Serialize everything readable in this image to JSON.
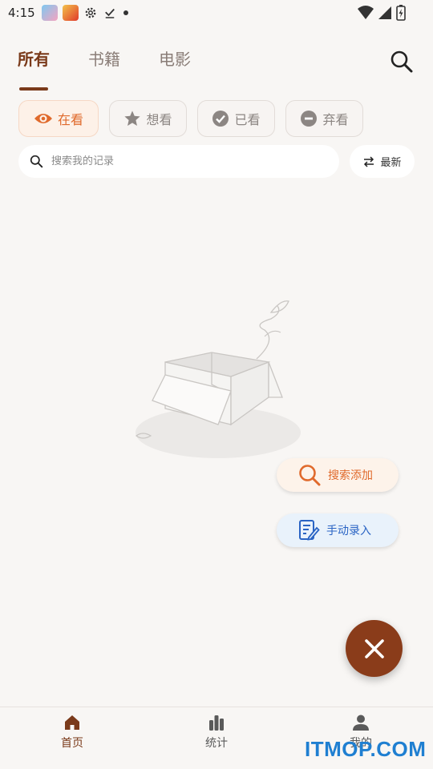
{
  "status_bar": {
    "time": "4:15"
  },
  "tabs": [
    {
      "label": "所有",
      "active": true
    },
    {
      "label": "书籍",
      "active": false
    },
    {
      "label": "电影",
      "active": false
    }
  ],
  "filters": [
    {
      "label": "在看",
      "icon": "eye-icon",
      "active": true
    },
    {
      "label": "想看",
      "icon": "star-icon",
      "active": false
    },
    {
      "label": "已看",
      "icon": "check-circle-icon",
      "active": false
    },
    {
      "label": "弃看",
      "icon": "minus-circle-icon",
      "active": false
    }
  ],
  "search": {
    "placeholder": "搜索我的记录"
  },
  "sort": {
    "label": "最新"
  },
  "speed_dial": {
    "search_add": "搜索添加",
    "manual_entry": "手动录入"
  },
  "bottom_nav": [
    {
      "label": "首页",
      "icon": "home-icon",
      "active": true
    },
    {
      "label": "统计",
      "icon": "bar-chart-icon",
      "active": false
    },
    {
      "label": "我的",
      "icon": "person-icon",
      "active": false
    }
  ],
  "watermark": "ITMOP.COM",
  "colors": {
    "accent": "#7a3a1a",
    "orange": "#e06a2c",
    "blue": "#2a64c4",
    "background": "#f8f6f4"
  }
}
